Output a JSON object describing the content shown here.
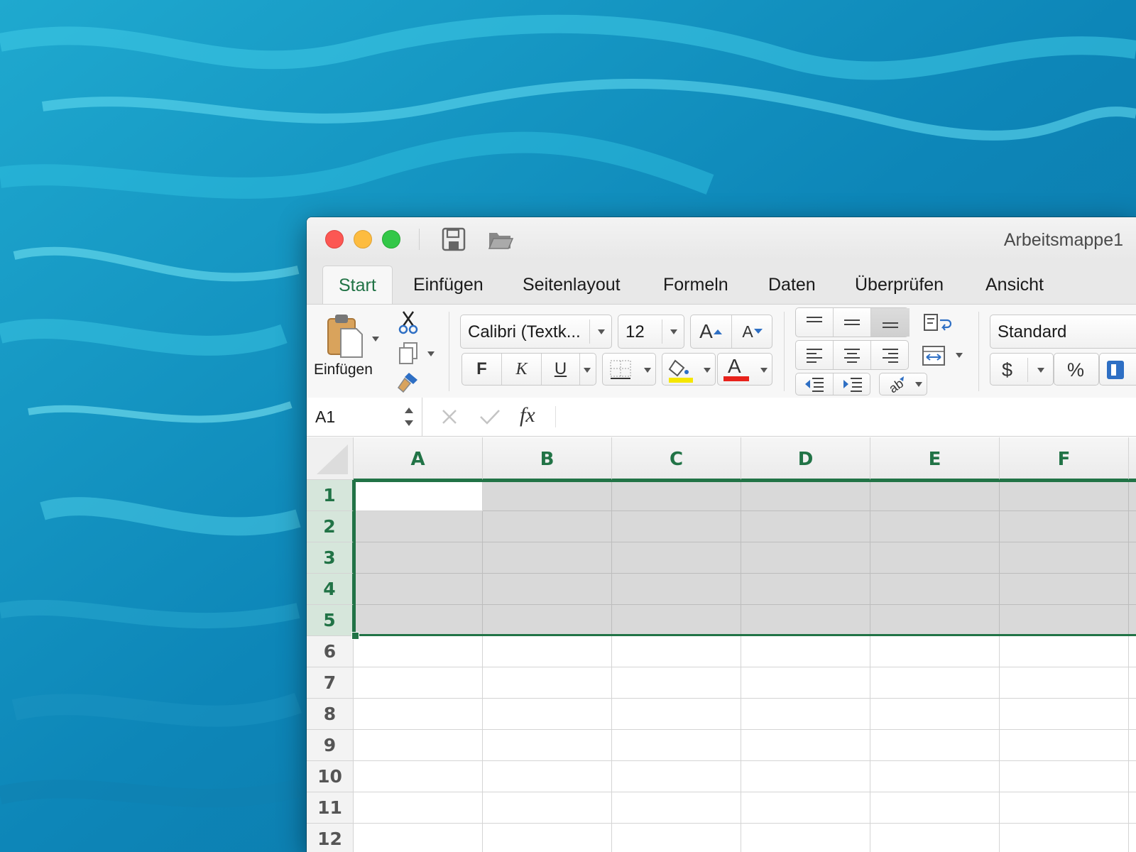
{
  "window": {
    "title": "Arbeitsmappe1",
    "traffic_lights": [
      "close",
      "minimize",
      "zoom"
    ],
    "quick_access": [
      "save-icon",
      "open-folder-icon"
    ]
  },
  "tabs": [
    {
      "label": "Start",
      "active": true
    },
    {
      "label": "Einfügen"
    },
    {
      "label": "Seitenlayout"
    },
    {
      "label": "Formeln"
    },
    {
      "label": "Daten"
    },
    {
      "label": "Überprüfen"
    },
    {
      "label": "Ansicht"
    }
  ],
  "ribbon": {
    "paste_label": "Einfügen",
    "font_name": "Calibri (Textk...",
    "font_size": "12",
    "bold": "F",
    "italic": "K",
    "underline": "U",
    "grow_font": "A",
    "shrink_font": "A",
    "font_color_glyph": "A",
    "number_format": "Standard",
    "currency": "$",
    "percent": "%",
    "colors": {
      "highlight": "#f5e600",
      "font_color": "#e8221b",
      "accent": "#217346"
    }
  },
  "formula_bar": {
    "name_box": "A1",
    "fx": "fx",
    "value": ""
  },
  "sheet": {
    "columns": [
      "A",
      "B",
      "C",
      "D",
      "E",
      "F"
    ],
    "rows": [
      "1",
      "2",
      "3",
      "4",
      "5",
      "6",
      "7",
      "8",
      "9",
      "10",
      "11",
      "12"
    ],
    "selection": "A1:F5",
    "active_cell": "A1"
  }
}
